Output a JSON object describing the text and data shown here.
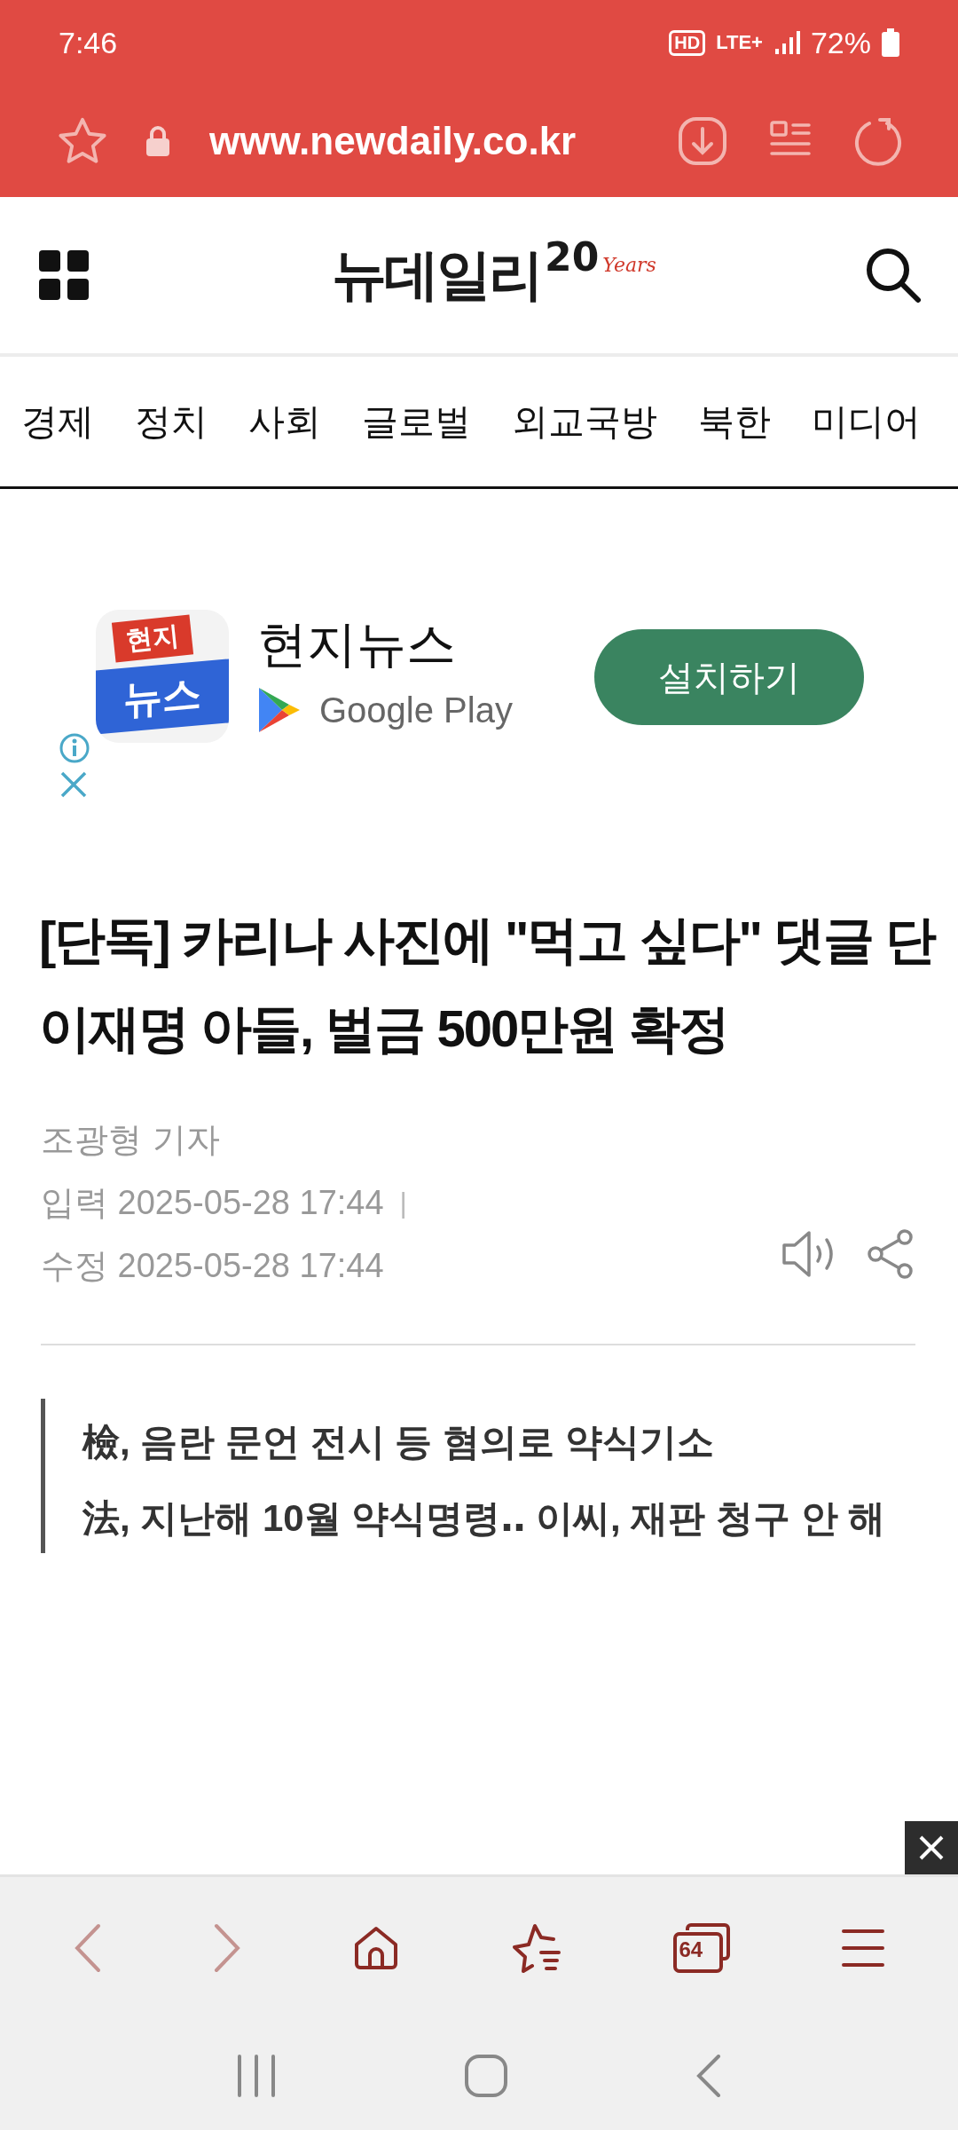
{
  "status_bar": {
    "time": "7:46",
    "hd": "HD",
    "network": "LTE+",
    "battery": "72%"
  },
  "url_bar": {
    "url": "www.newdaily.co.kr"
  },
  "header": {
    "logo": "뉴데일리",
    "logo_number": "20",
    "logo_tagline": "Years"
  },
  "nav": [
    "경제",
    "정치",
    "사회",
    "글로벌",
    "외교국방",
    "북한",
    "미디어"
  ],
  "ad": {
    "icon_top": "현지",
    "icon_bottom": "뉴스",
    "app_name": "현지뉴스",
    "store": "Google Play",
    "button": "설치하기"
  },
  "article": {
    "headline": "[단독] 카리나 사진에 \"먹고 싶다\" 댓글 단 이재명 아들, 벌금 500만원 확정",
    "reporter": "조광형 기자",
    "entered": "입력 2025-05-28 17:44",
    "separator": "|",
    "modified": "수정 2025-05-28 17:44",
    "subheads": [
      "檢, 음란 문언 전시 등 혐의로 약식기소",
      "法, 지난해 10월 약식명령‥ 이씨, 재판 청구 안 해"
    ]
  },
  "bottom_toolbar": {
    "tab_count": "64"
  }
}
